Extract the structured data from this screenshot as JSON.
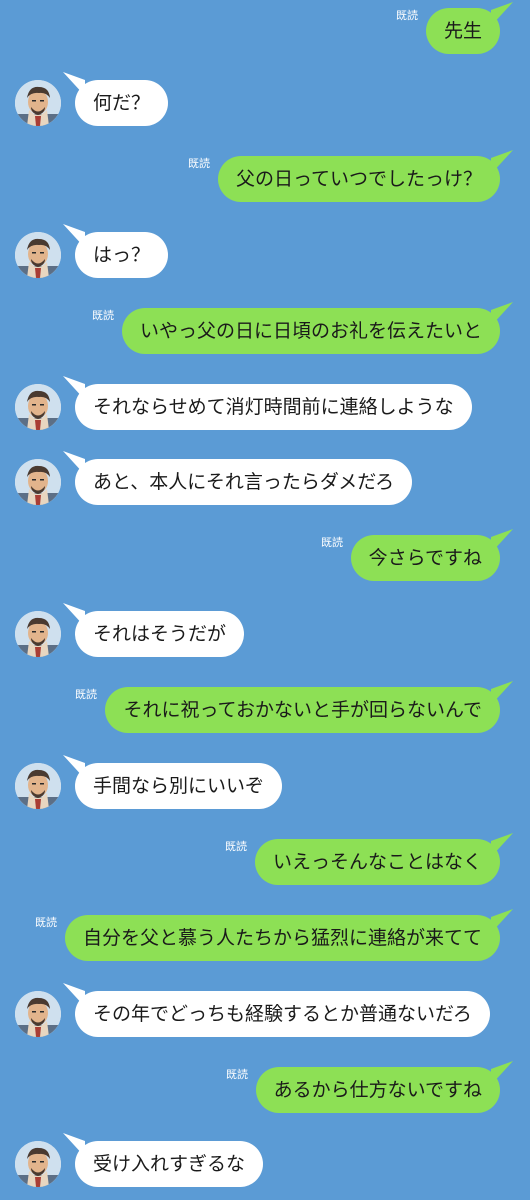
{
  "read_label": "既読",
  "messages": [
    {
      "side": "out",
      "text": "先生",
      "read": true
    },
    {
      "side": "in",
      "text": "何だ？"
    },
    {
      "side": "out",
      "text": "父の日っていつでしたっけ？",
      "read": true
    },
    {
      "side": "in",
      "text": "はっ？"
    },
    {
      "side": "out",
      "text": "いやっ父の日に日頃のお礼を伝えたいと",
      "read": true
    },
    {
      "side": "in",
      "text": "それならせめて消灯時間前に連絡しような"
    },
    {
      "side": "in",
      "text": "あと、本人にそれ言ったらダメだろ"
    },
    {
      "side": "out",
      "text": "今さらですね",
      "read": true
    },
    {
      "side": "in",
      "text": "それはそうだが"
    },
    {
      "side": "out",
      "text": "それに祝っておかないと手が回らないんで",
      "read": true
    },
    {
      "side": "in",
      "text": "手間なら別にいいぞ"
    },
    {
      "side": "out",
      "text": "いえっそんなことはなく",
      "read": true
    },
    {
      "side": "out",
      "text": "自分を父と慕う人たちから猛烈に連絡が来てて",
      "read": true
    },
    {
      "side": "in",
      "text": "その年でどっちも経験するとか普通ないだろ"
    },
    {
      "side": "out",
      "text": "あるから仕方ないですね",
      "read": true
    },
    {
      "side": "in",
      "text": "受け入れすぎるな"
    }
  ]
}
